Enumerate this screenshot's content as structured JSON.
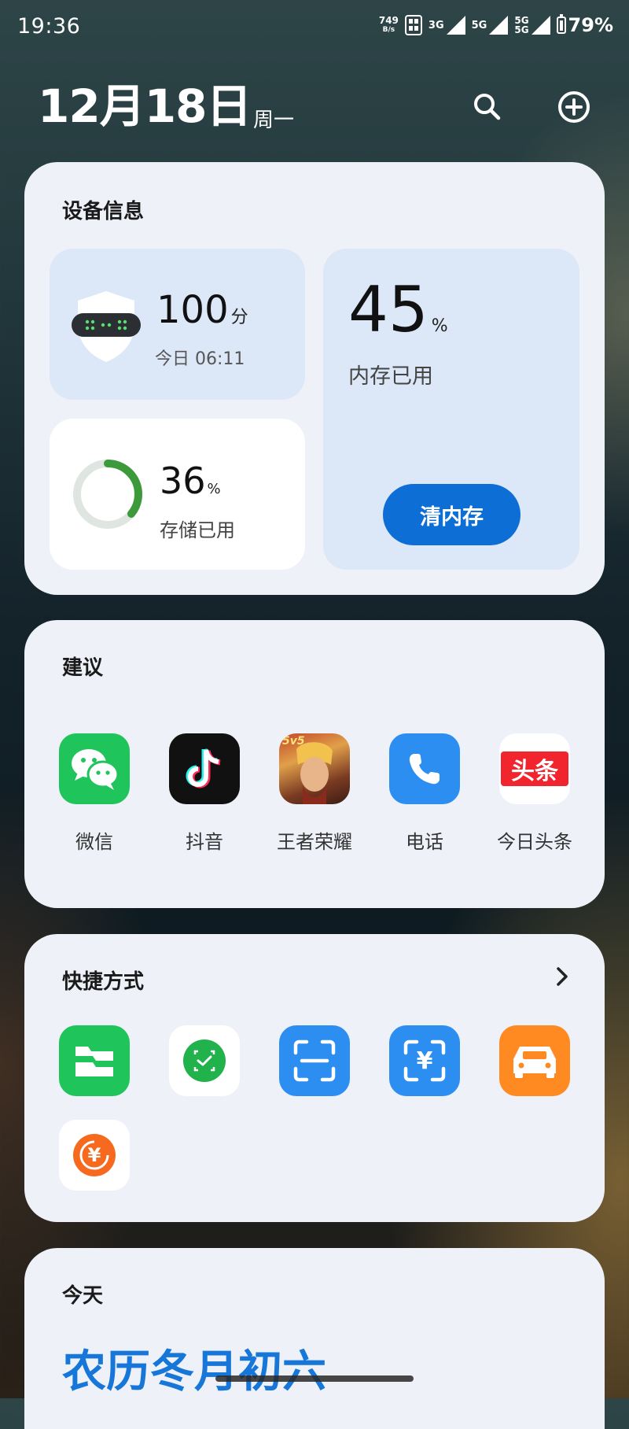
{
  "status_bar": {
    "time": "19:36",
    "net_speed_value": "749",
    "net_speed_unit": "B/s",
    "signal1": "3G",
    "signal2": "5G",
    "signal3_top": "5G",
    "signal3_bottom": "5G",
    "battery": "79%"
  },
  "header": {
    "date": "12月18日",
    "weekday": "周一",
    "search_icon": "search-icon",
    "add_icon": "plus-circle-icon"
  },
  "device_info": {
    "title": "设备信息",
    "security": {
      "score": "100",
      "unit": "分",
      "time": "今日 06:11",
      "icon": "shield-icon"
    },
    "memory": {
      "value": "45",
      "unit": "%",
      "label": "内存已用",
      "button": "清内存",
      "fraction": 0.45
    },
    "storage": {
      "value": "36",
      "unit": "%",
      "label": "存储已用",
      "fraction": 0.36
    }
  },
  "suggestions": {
    "title": "建议",
    "apps": [
      {
        "label": "微信",
        "icon": "wechat-icon"
      },
      {
        "label": "抖音",
        "icon": "douyin-icon"
      },
      {
        "label": "王者荣耀",
        "icon": "honor-of-kings-icon",
        "badge": "5v5"
      },
      {
        "label": "电话",
        "icon": "phone-icon"
      },
      {
        "label": "今日头条",
        "icon": "toutiao-icon",
        "icon_text": "头条"
      }
    ]
  },
  "shortcuts": {
    "title": "快捷方式",
    "more_icon": "chevron-right-icon",
    "items": [
      {
        "icon": "files-icon"
      },
      {
        "icon": "scan-check-icon"
      },
      {
        "icon": "scan-icon"
      },
      {
        "icon": "scan-pay-icon",
        "glyph": "¥"
      },
      {
        "icon": "car-icon"
      },
      {
        "icon": "payment-icon",
        "glyph": "¥"
      }
    ]
  },
  "today": {
    "title": "今天",
    "lunar": "农历冬月初六"
  },
  "colors": {
    "card_bg": "#eef1f8",
    "tile_blue": "#dce7f7",
    "accent_blue": "#0d6fd6",
    "storage_ring": "#3d9a3a",
    "lunar_text": "#1677d9"
  }
}
